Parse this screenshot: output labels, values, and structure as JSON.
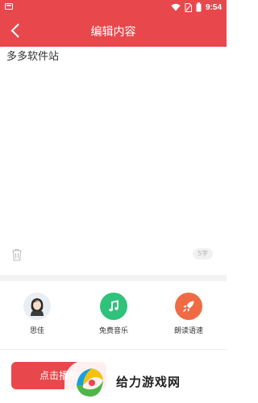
{
  "status_bar": {
    "time": "9:54"
  },
  "header": {
    "title": "编辑内容"
  },
  "editor": {
    "text": "多多软件站",
    "char_count": "5字"
  },
  "options": [
    {
      "label": "思佳",
      "icon": "avatar-icon",
      "color": "#e9eef2"
    },
    {
      "label": "免费音乐",
      "icon": "music-note-icon",
      "color": "#2fc27a"
    },
    {
      "label": "朗读语速",
      "icon": "rocket-icon",
      "color": "#f06b44"
    }
  ],
  "actions": {
    "play_label": "点击播放"
  },
  "watermark": {
    "text": "给力游戏网"
  },
  "colors": {
    "accent": "#e8484c"
  }
}
